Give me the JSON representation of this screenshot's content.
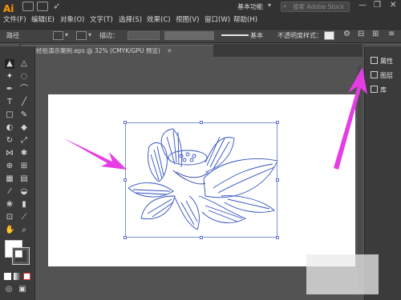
{
  "app": {
    "logo": "Ai",
    "accent": "#ff9a00"
  },
  "menu": {
    "items": [
      "文件(F)",
      "编辑(E)",
      "对象(O)",
      "文字(T)",
      "选择(S)",
      "效果(C)",
      "视图(V)",
      "窗口(W)",
      "帮助(H)"
    ]
  },
  "topbar": {
    "workspace": "基本功能",
    "search_placeholder": "搜索 Adobe Stock",
    "minimize": "—",
    "restore": "❐",
    "close": "✕"
  },
  "controlbar": {
    "selection_label": "路径",
    "stroke_label": "描边：",
    "stroke_style": "基本",
    "opacity_label": "不透明度",
    "style_label": "样式："
  },
  "document": {
    "tab_label": "百度经验演示案例.eps @ 32% (CMYK/GPU 预览)",
    "close": "✕"
  },
  "right_panel": {
    "items": [
      {
        "label": "属性",
        "icon": "properties-icon"
      },
      {
        "label": "图层",
        "icon": "layers-icon"
      },
      {
        "label": "库",
        "icon": "libraries-icon"
      }
    ]
  },
  "annotations": {
    "arrow_color": "#e63ce6",
    "artwork_stroke": "#2f4fbf"
  }
}
